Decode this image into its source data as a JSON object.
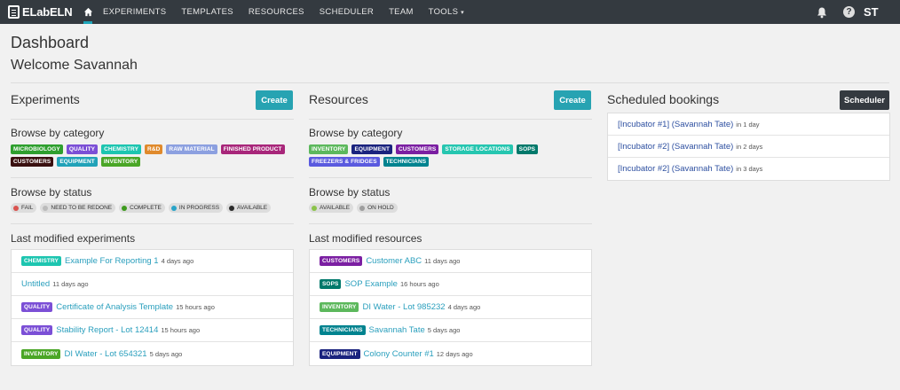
{
  "nav": {
    "brand": "ELabELN",
    "items": [
      "EXPERIMENTS",
      "TEMPLATES",
      "RESOURCES",
      "SCHEDULER",
      "TEAM"
    ],
    "tools": "TOOLS",
    "user_initials": "ST",
    "help": "?"
  },
  "page": {
    "title": "Dashboard",
    "welcome": "Welcome Savannah"
  },
  "experiments": {
    "title": "Experiments",
    "create": "Create",
    "browse_category": "Browse by category",
    "categories": [
      {
        "label": "MICROBIOLOGY",
        "color": "#2e9f2e"
      },
      {
        "label": "QUALITY",
        "color": "#7b4fd6"
      },
      {
        "label": "CHEMISTRY",
        "color": "#1dc5b0"
      },
      {
        "label": "R&D",
        "color": "#e08a2c"
      },
      {
        "label": "RAW MATERIAL",
        "color": "#8ca0e0"
      },
      {
        "label": "FINISHED PRODUCT",
        "color": "#a8267a"
      },
      {
        "label": "CUSTOMERS",
        "color": "#3a1010"
      },
      {
        "label": "EQUIPMENT",
        "color": "#21a2b8"
      },
      {
        "label": "INVENTORY",
        "color": "#4aa626"
      }
    ],
    "browse_status": "Browse by status",
    "statuses": [
      {
        "label": "FAIL",
        "color": "#d9534f"
      },
      {
        "label": "NEED TO BE REDONE",
        "color": "#bbbbbb"
      },
      {
        "label": "COMPLETE",
        "color": "#3e9a1e"
      },
      {
        "label": "IN PROGRESS",
        "color": "#2aa4c8"
      },
      {
        "label": "AVAILABLE",
        "color": "#2b2b2b"
      }
    ],
    "last_modified": "Last modified experiments",
    "recent": [
      {
        "tag": "CHEMISTRY",
        "color": "#1dc5b0",
        "name": "Example For Reporting 1",
        "ago": "4 days ago"
      },
      {
        "tag": "",
        "color": "",
        "name": "Untitled",
        "ago": "11 days ago"
      },
      {
        "tag": "QUALITY",
        "color": "#7b4fd6",
        "name": "Certificate of Analysis Template",
        "ago": "15 hours ago"
      },
      {
        "tag": "QUALITY",
        "color": "#7b4fd6",
        "name": "Stability Report - Lot 12414",
        "ago": "15 hours ago"
      },
      {
        "tag": "INVENTORY",
        "color": "#4aa626",
        "name": "DI Water - Lot 654321",
        "ago": "5 days ago"
      }
    ]
  },
  "resources": {
    "title": "Resources",
    "create": "Create",
    "browse_category": "Browse by category",
    "categories": [
      {
        "label": "INVENTORY",
        "color": "#5cb85c"
      },
      {
        "label": "EQUIPMENT",
        "color": "#1a237e"
      },
      {
        "label": "CUSTOMERS",
        "color": "#7b1fa2"
      },
      {
        "label": "STORAGE LOCATIONS",
        "color": "#26c6b0"
      },
      {
        "label": "SOPS",
        "color": "#00796b"
      },
      {
        "label": "FREEZERS & FRIDGES",
        "color": "#5a5adf"
      },
      {
        "label": "TECHNICIANS",
        "color": "#00838f"
      }
    ],
    "browse_status": "Browse by status",
    "statuses": [
      {
        "label": "AVAILABLE",
        "color": "#8bc34a"
      },
      {
        "label": "ON HOLD",
        "color": "#9e9e9e"
      }
    ],
    "last_modified": "Last modified resources",
    "recent": [
      {
        "tag": "CUSTOMERS",
        "color": "#7b1fa2",
        "name": "Customer ABC",
        "ago": "11 days ago"
      },
      {
        "tag": "SOPS",
        "color": "#00796b",
        "name": "SOP Example",
        "ago": "16 hours ago"
      },
      {
        "tag": "INVENTORY",
        "color": "#5cb85c",
        "name": "DI Water - Lot 985232",
        "ago": "4 days ago"
      },
      {
        "tag": "TECHNICIANS",
        "color": "#00838f",
        "name": "Savannah Tate",
        "ago": "5 days ago"
      },
      {
        "tag": "EQUIPMENT",
        "color": "#1a237e",
        "name": "Colony Counter #1",
        "ago": "12 days ago"
      }
    ]
  },
  "bookings": {
    "title": "Scheduled bookings",
    "scheduler": "Scheduler",
    "items": [
      {
        "name": "[Incubator #1] (Savannah Tate)",
        "when": "in 1 day"
      },
      {
        "name": "[Incubator #2] (Savannah Tate)",
        "when": "in 2 days"
      },
      {
        "name": "[Incubator #2] (Savannah Tate)",
        "when": "in 3 days"
      }
    ]
  }
}
